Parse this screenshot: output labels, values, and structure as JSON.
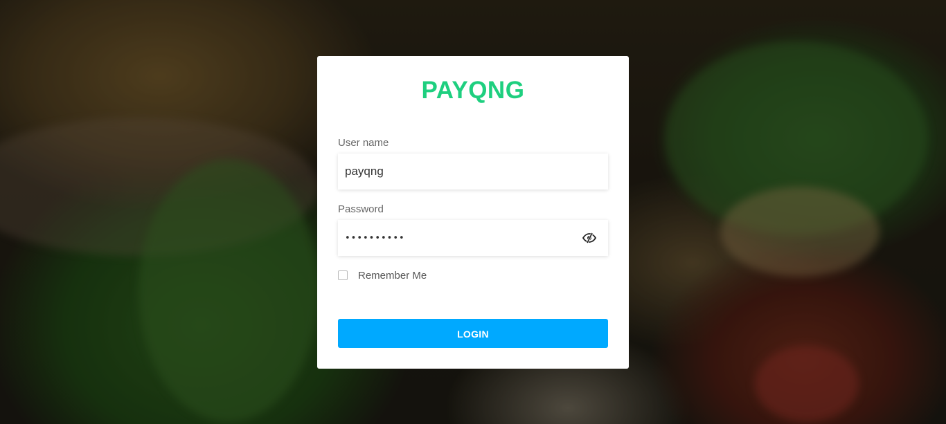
{
  "brand": {
    "name": "PAYQNG",
    "color": "#1ecf7f"
  },
  "login_form": {
    "username_label": "User name",
    "username_value": "payqng",
    "password_label": "Password",
    "password_value": "••••••••••",
    "password_toggle_icon": "eye-slash-icon",
    "remember_label": "Remember Me",
    "remember_checked": false,
    "submit_label": "LOGIN",
    "submit_color": "#00a9ff"
  }
}
